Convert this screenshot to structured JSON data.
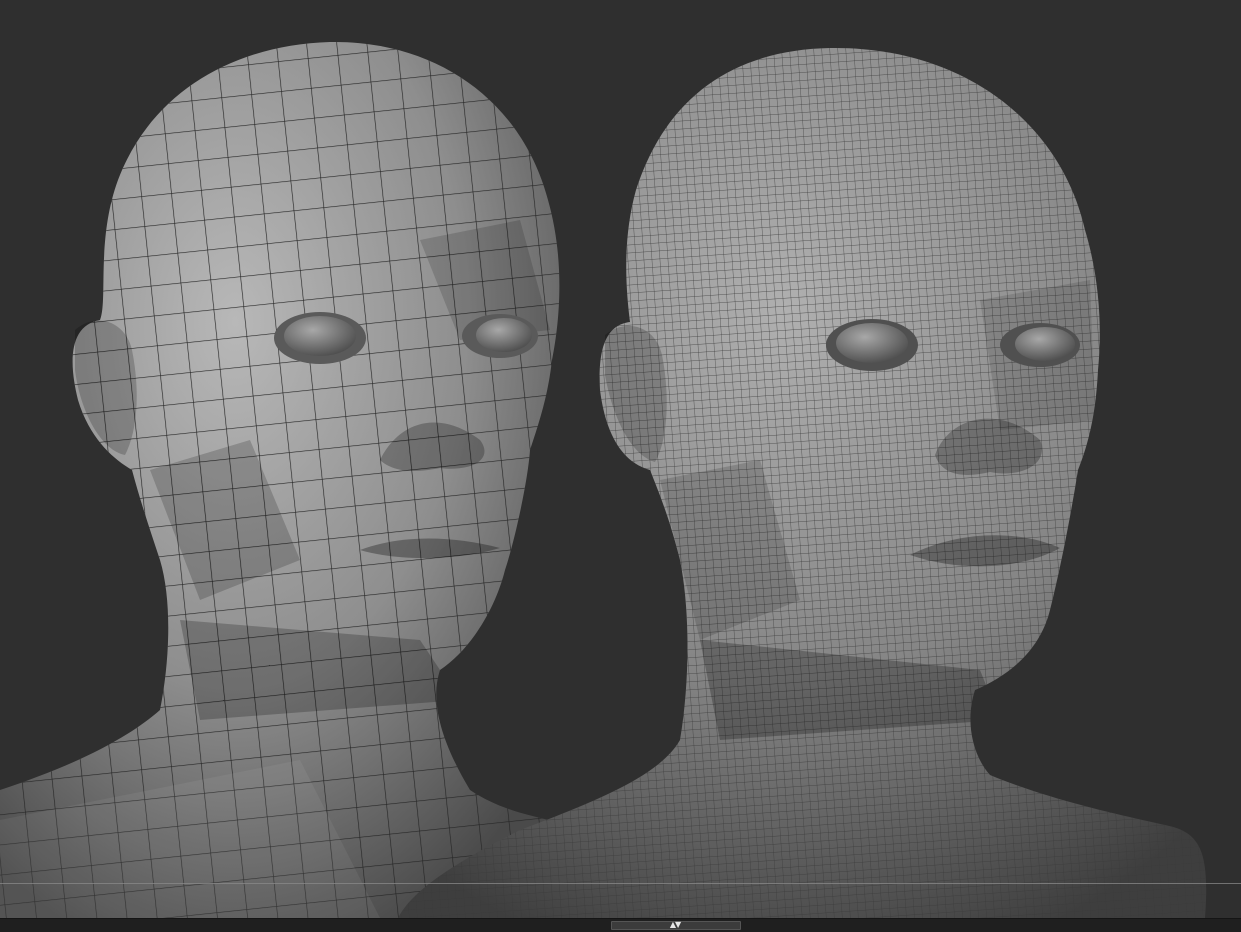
{
  "viewport": {
    "background": "#2f2f2f",
    "models": [
      {
        "id": "lowpoly-head",
        "shade": "#9a9a9a",
        "wire": "#2a2a2a",
        "density": 18
      },
      {
        "id": "subdivided-head",
        "shade": "#8c8c8c",
        "wire": "#3a3a3a",
        "density": 48
      }
    ]
  },
  "bottom_bar": {
    "background": "#1f1f1f",
    "handle_icon": "collapse-arrows-icon",
    "arrows": "▲▼"
  }
}
